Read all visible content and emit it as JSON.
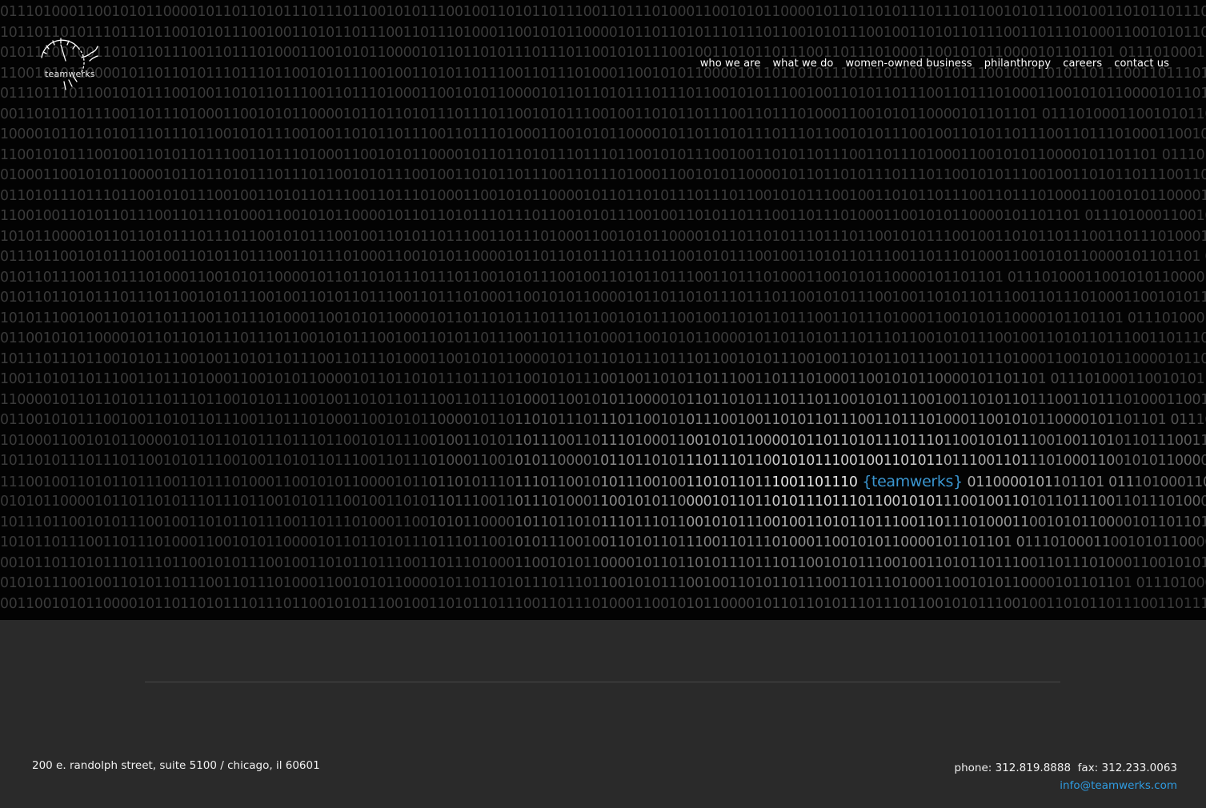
{
  "logo": {
    "text": "teamwerks",
    "icon": "stopwatch-icon"
  },
  "nav": {
    "items": [
      {
        "label": "who we are"
      },
      {
        "label": "what we do"
      },
      {
        "label": "women-owned business"
      },
      {
        "label": "philanthropy"
      },
      {
        "label": "careers"
      },
      {
        "label": "contact us"
      }
    ]
  },
  "hero": {
    "binary_string": "01110100011001010110000101101101011101110110010101110010011010110111001101110100011001010110000101101101011101110110010101110010011010110111001101110100011001010110000101101101",
    "brand_word": "{teamwerks}"
  },
  "footer": {
    "address": "200 e. randolph street, suite 5100 / chicago, il 60601",
    "phone": "phone: 312.819.8888",
    "fax": "fax: 312.233.0063",
    "email": "info@teamwerks.com"
  },
  "colors": {
    "accent_blue": "#2f9be0",
    "hero_background": "#030303",
    "footer_background": "#2a2a2a"
  }
}
